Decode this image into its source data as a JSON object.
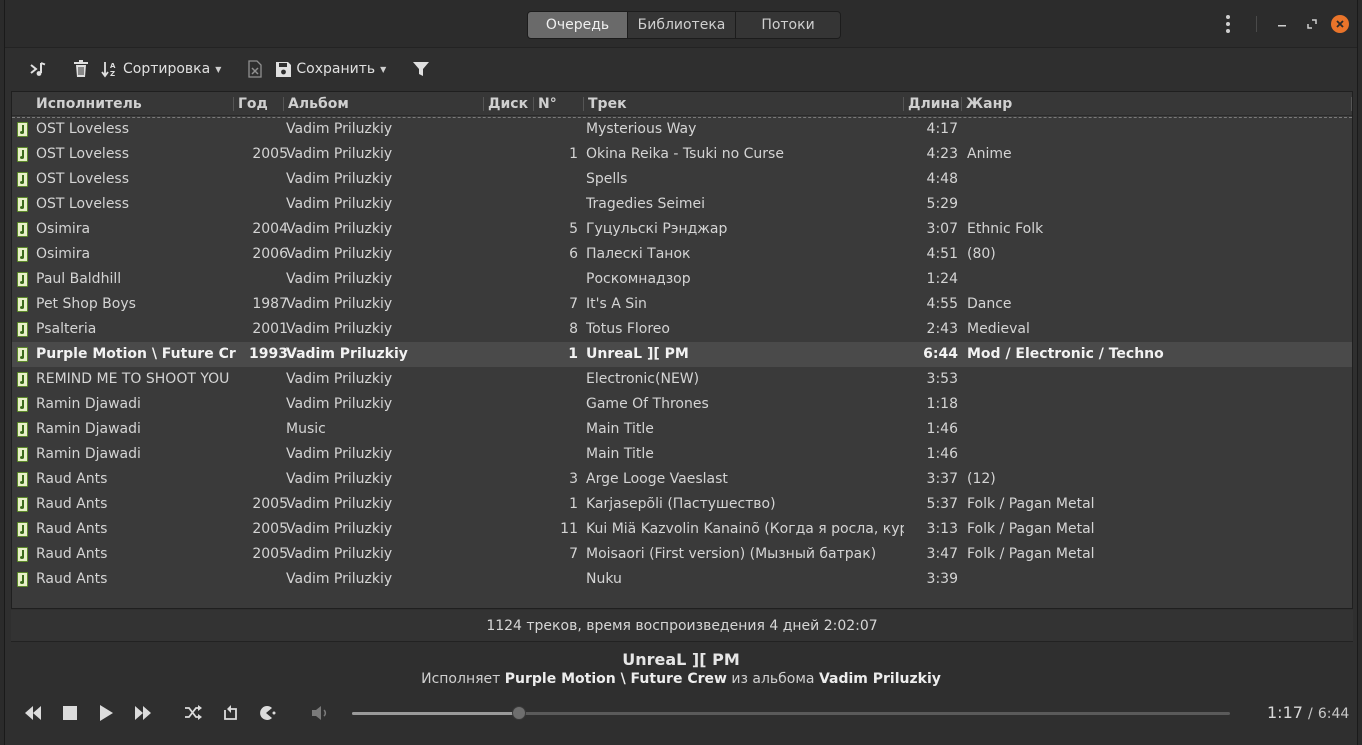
{
  "header": {
    "tabs": [
      {
        "label": "Очередь",
        "active": true
      },
      {
        "label": "Библиотека",
        "active": false
      },
      {
        "label": "Потоки",
        "active": false
      }
    ]
  },
  "toolbar": {
    "sort_label": "Сортировка",
    "save_label": "Сохранить"
  },
  "columns": {
    "artist": "Исполнитель",
    "year": "Год",
    "album": "Альбом",
    "disc": "Диск",
    "num": "N°",
    "track": "Трек",
    "length": "Длина",
    "genre": "Жанр"
  },
  "rows": [
    {
      "artist": "OST Loveless",
      "year": "",
      "album": "Vadim Priluzkiy",
      "disc": "",
      "num": "",
      "track": "Mysterious Way",
      "length": "4:17",
      "genre": ""
    },
    {
      "artist": "OST Loveless",
      "year": "2005",
      "album": "Vadim Priluzkiy",
      "disc": "",
      "num": "1",
      "track": "Okina Reika - Tsuki no Curse",
      "length": "4:23",
      "genre": "Anime"
    },
    {
      "artist": "OST Loveless",
      "year": "",
      "album": "Vadim Priluzkiy",
      "disc": "",
      "num": "",
      "track": "Spells",
      "length": "4:48",
      "genre": ""
    },
    {
      "artist": "OST Loveless",
      "year": "",
      "album": "Vadim Priluzkiy",
      "disc": "",
      "num": "",
      "track": "Tragedies Seimei",
      "length": "5:29",
      "genre": ""
    },
    {
      "artist": "Osimira",
      "year": "2004",
      "album": "Vadim Priluzkiy",
      "disc": "",
      "num": "5",
      "track": "Гуцульскі Рэнджар",
      "length": "3:07",
      "genre": "Ethnic Folk"
    },
    {
      "artist": "Osimira",
      "year": "2006",
      "album": "Vadim Priluzkiy",
      "disc": "",
      "num": "6",
      "track": "Палескі Танок",
      "length": "4:51",
      "genre": "(80)"
    },
    {
      "artist": "Paul Baldhill",
      "year": "",
      "album": "Vadim Priluzkiy",
      "disc": "",
      "num": "",
      "track": "Роскомнадзор",
      "length": "1:24",
      "genre": ""
    },
    {
      "artist": "Pet Shop Boys",
      "year": "1987",
      "album": "Vadim Priluzkiy",
      "disc": "",
      "num": "7",
      "track": "It's A Sin",
      "length": "4:55",
      "genre": "Dance"
    },
    {
      "artist": "Psalteria",
      "year": "2001",
      "album": "Vadim Priluzkiy",
      "disc": "",
      "num": "8",
      "track": "Totus Floreo",
      "length": "2:43",
      "genre": "Medieval"
    },
    {
      "artist": "Purple Motion \\ Future Crew",
      "year": "1993",
      "album": "Vadim Priluzkiy",
      "disc": "",
      "num": "1",
      "track": "UnreaL ][  PM",
      "length": "6:44",
      "genre": "Mod / Electronic / Techno",
      "playing": true
    },
    {
      "artist": "REMIND ME TO SHOOT YOU",
      "year": "",
      "album": "Vadim Priluzkiy",
      "disc": "",
      "num": "",
      "track": "Electronic(NEW)",
      "length": "3:53",
      "genre": ""
    },
    {
      "artist": "Ramin Djawadi",
      "year": "",
      "album": "Vadim Priluzkiy",
      "disc": "",
      "num": "",
      "track": "Game Of Thrones",
      "length": "1:18",
      "genre": ""
    },
    {
      "artist": "Ramin Djawadi",
      "year": "",
      "album": "Music",
      "disc": "",
      "num": "",
      "track": "Main Title",
      "length": "1:46",
      "genre": ""
    },
    {
      "artist": "Ramin Djawadi",
      "year": "",
      "album": "Vadim Priluzkiy",
      "disc": "",
      "num": "",
      "track": "Main Title",
      "length": "1:46",
      "genre": ""
    },
    {
      "artist": "Raud Ants",
      "year": "",
      "album": "Vadim Priluzkiy",
      "disc": "",
      "num": "3",
      "track": "Arge Looge  Vaeslast",
      "length": "3:37",
      "genre": "(12)"
    },
    {
      "artist": "Raud Ants",
      "year": "2005",
      "album": "Vadim Priluzkiy",
      "disc": "",
      "num": "1",
      "track": "Karjasepõli (Пастушество)",
      "length": "5:37",
      "genre": "Folk / Pagan Metal"
    },
    {
      "artist": "Raud Ants",
      "year": "2005",
      "album": "Vadim Priluzkiy",
      "disc": "",
      "num": "11",
      "track": "Kui Miä Kazvolin Kanainõ (Когда я росла, курочк",
      "length": "3:13",
      "genre": "Folk / Pagan Metal"
    },
    {
      "artist": "Raud Ants",
      "year": "2005",
      "album": "Vadim Priluzkiy",
      "disc": "",
      "num": "7",
      "track": "Moisaori (First version) (Мызный батрак)",
      "length": "3:47",
      "genre": "Folk / Pagan Metal"
    },
    {
      "artist": "Raud Ants",
      "year": "",
      "album": "Vadim Priluzkiy",
      "disc": "",
      "num": "",
      "track": "Nuku",
      "length": "3:39",
      "genre": ""
    }
  ],
  "status": "1124 треков, время воспроизведения 4 дней 2:02:07",
  "now_playing": {
    "title": "UnreaL ][  PM",
    "performs_label": "Исполняет",
    "artist": "Purple Motion \\ Future Crew",
    "from_album_label": "из альбома",
    "album": "Vadim Priluzkiy"
  },
  "playback": {
    "elapsed": "1:17",
    "separator": "/",
    "total": "6:44",
    "progress_fraction": 0.19
  },
  "icons": {
    "previous": "skip-back-icon",
    "stop": "stop-icon",
    "play": "play-icon",
    "next": "skip-forward-icon",
    "shuffle": "shuffle-icon",
    "repeat": "repeat-icon",
    "consume": "pacman-icon",
    "volume": "volume-icon"
  },
  "colors": {
    "close_button": "#e9742a",
    "file_icon": "#e8f0c8"
  }
}
